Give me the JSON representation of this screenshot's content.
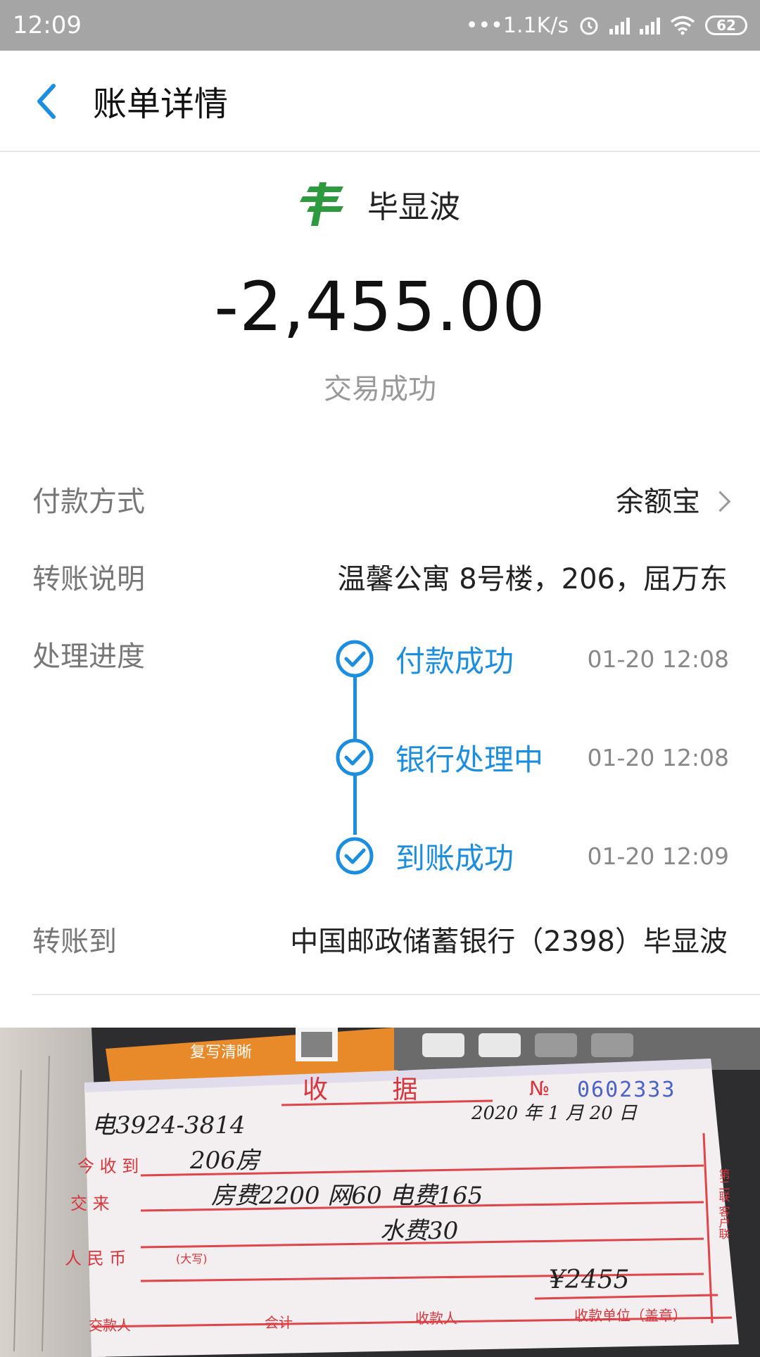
{
  "status_bar": {
    "time": "12:09",
    "network_speed": "•••1.1K/s",
    "battery": "62"
  },
  "header": {
    "title": "账单详情"
  },
  "payee": {
    "name": "毕显波",
    "logo": "china-post-logo"
  },
  "amount": "-2,455.00",
  "status": "交易成功",
  "details": {
    "payment_method": {
      "label": "付款方式",
      "value": "余额宝"
    },
    "transfer_note": {
      "label": "转账说明",
      "value": "温馨公寓 8号楼，206，屈万东"
    },
    "progress": {
      "label": "处理进度",
      "steps": [
        {
          "label": "付款成功",
          "time": "01-20 12:08"
        },
        {
          "label": "银行处理中",
          "time": "01-20 12:08"
        },
        {
          "label": "到账成功",
          "time": "01-20 12:09"
        }
      ]
    },
    "transfer_to": {
      "label": "转账到",
      "value": "中国邮政储蓄银行（2398）毕显波"
    }
  },
  "receipt": {
    "title": "收 据",
    "no_label": "№",
    "number": "0602333",
    "handwritten_phone": "电3924-3814",
    "date": "2020 年 1 月 20 日",
    "received_from_label": "今 收 到",
    "received_from": "206房",
    "paid_for_label": "交 来",
    "paid_for": "房费2200  网60  电费165",
    "paid_for_2": "水费30",
    "rmb_label": "人 民 币",
    "uppercase_label": "(大写)",
    "amount": "¥2455",
    "footer": [
      "交款人",
      "会计",
      "收款人",
      "收款单位（盖章）"
    ],
    "side_label": "第二联 客户联",
    "top_label": "复写清晰"
  }
}
